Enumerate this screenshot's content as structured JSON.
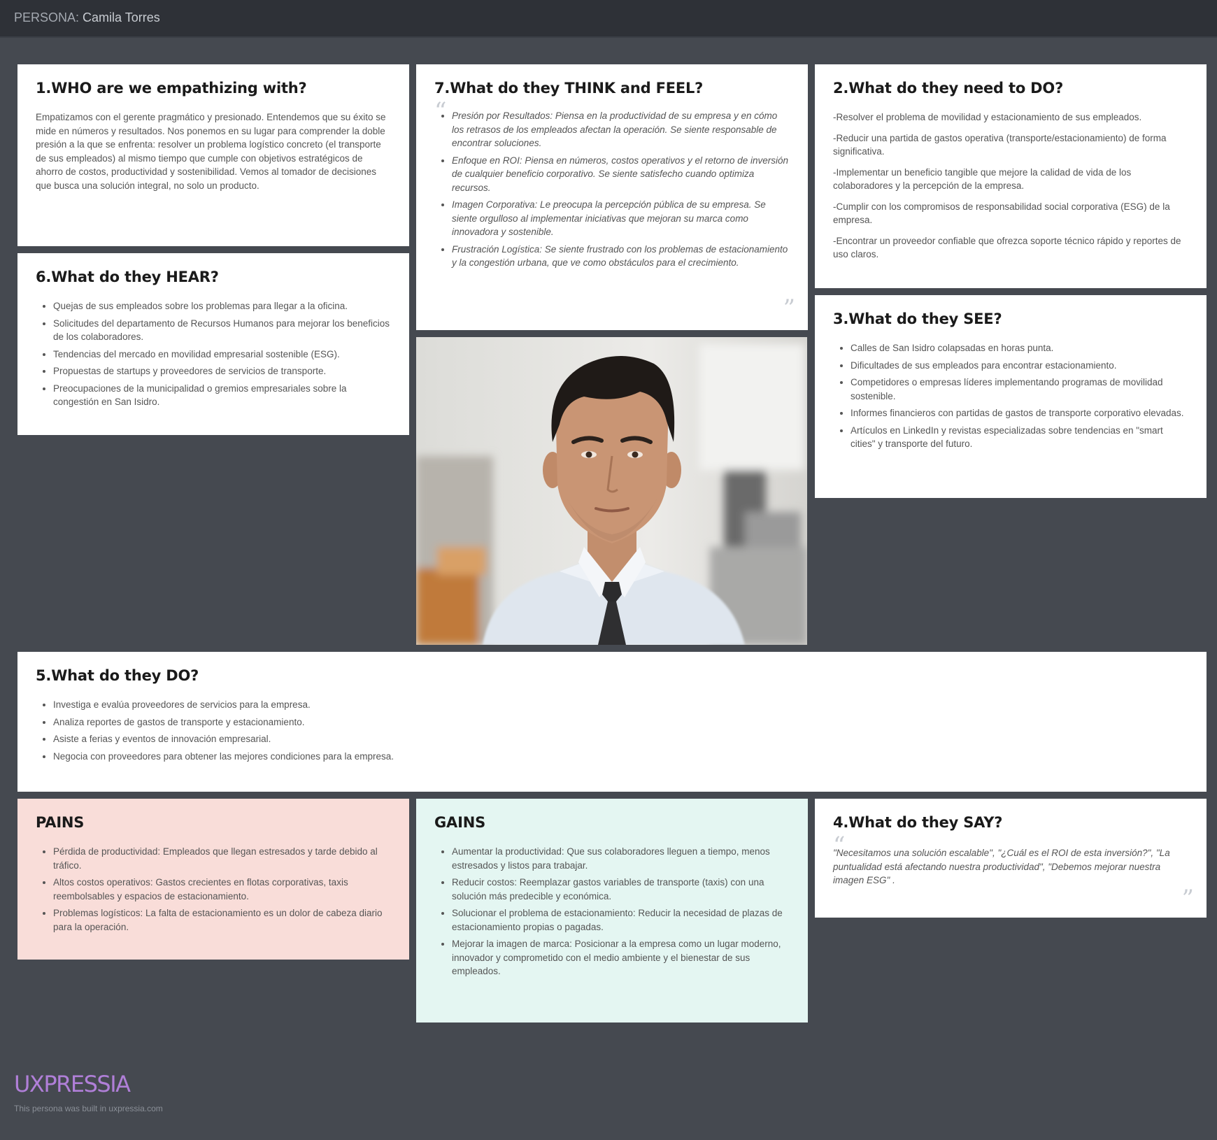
{
  "header": {
    "prefix": "PERSONA:",
    "name": "Camila Torres"
  },
  "who": {
    "title": "1.WHO are we empathizing with?",
    "body": "Empatizamos con el gerente pragmático y presionado. Entendemos que su éxito se mide en números y resultados. Nos ponemos en su lugar para comprender la doble presión a la que se enfrenta: resolver un problema logístico concreto (el transporte de sus empleados) al mismo tiempo que cumple con objetivos estratégicos de ahorro de costos, productividad y sostenibilidad. Vemos al tomador de decisiones que busca una solución integral, no solo un producto."
  },
  "think": {
    "title": "7.What do they THINK and FEEL?",
    "items": [
      "Presión por Resultados: Piensa en la productividad de su empresa y en cómo los retrasos de los empleados afectan la operación. Se siente responsable de encontrar soluciones.",
      "Enfoque en ROI: Piensa en números, costos operativos y el retorno de inversión de cualquier beneficio corporativo. Se siente satisfecho cuando optimiza recursos.",
      "Imagen Corporativa: Le preocupa la percepción pública de su empresa. Se siente orgulloso al implementar iniciativas que mejoran su marca como innovadora y sostenible.",
      "Frustración Logística: Se siente frustrado con los problemas de estacionamiento y la congestión urbana, que ve como obstáculos para el crecimiento."
    ]
  },
  "need": {
    "title": "2.What do they need to DO?",
    "items": [
      "-Resolver el problema de movilidad y estacionamiento de sus empleados.",
      "-Reducir una partida de gastos operativa (transporte/estacionamiento) de forma significativa.",
      "-Implementar un beneficio tangible que mejore la calidad de vida de los colaboradores y la percepción de la empresa.",
      "-Cumplir con los compromisos de responsabilidad social corporativa (ESG) de la empresa.",
      "-Encontrar un proveedor confiable que ofrezca soporte técnico rápido y reportes de uso claros."
    ]
  },
  "hear": {
    "title": "6.What do they HEAR?",
    "items": [
      "Quejas de sus empleados sobre los problemas para llegar a la oficina.",
      "Solicitudes del departamento de Recursos Humanos para mejorar los beneficios de los colaboradores.",
      "Tendencias del mercado en movilidad empresarial sostenible (ESG).",
      "Propuestas de startups y proveedores de servicios de transporte.",
      "Preocupaciones de la municipalidad o gremios empresariales sobre la congestión en San Isidro."
    ]
  },
  "see": {
    "title": "3.What do they SEE?",
    "items": [
      "Calles de San Isidro colapsadas en horas punta.",
      "Dificultades de sus empleados para encontrar estacionamiento.",
      "Competidores o empresas líderes implementando programas de movilidad sostenible.",
      "Informes financieros con partidas de gastos de transporte corporativo elevadas.",
      "Artículos en LinkedIn y revistas especializadas sobre tendencias en \"smart cities\" y transporte del futuro."
    ]
  },
  "do": {
    "title": "5.What do they DO?",
    "items": [
      "Investiga e evalúa proveedores de servicios para la empresa.",
      "Analiza reportes de gastos de transporte y estacionamiento.",
      "Asiste a ferias y eventos de innovación empresarial.",
      "Negocia con proveedores para obtener las mejores condiciones para la empresa."
    ]
  },
  "pains": {
    "title": "PAINS",
    "items": [
      "Pérdida de productividad: Empleados que llegan estresados y tarde debido al tráfico.",
      "Altos costos operativos: Gastos crecientes en flotas corporativas, taxis reembolsables y espacios de estacionamiento.",
      "Problemas logísticos: La falta de estacionamiento es un dolor de cabeza diario para la operación."
    ]
  },
  "gains": {
    "title": "GAINS",
    "items": [
      "Aumentar la productividad: Que sus colaboradores lleguen a tiempo, menos estresados y listos para trabajar.",
      "Reducir costos: Reemplazar gastos variables de transporte (taxis) con una solución más predecible y económica.",
      "Solucionar el problema de estacionamiento: Reducir la necesidad de plazas de estacionamiento propias o pagadas.",
      "Mejorar la imagen de marca: Posicionar a la empresa como un lugar moderno, innovador y comprometido con el medio ambiente y el bienestar de sus empleados."
    ]
  },
  "say": {
    "title": "4.What do they SAY?",
    "quote": "\"Necesitamos una solución escalable\", \"¿Cuál es el ROI de esta inversión?\", \"La puntualidad está afectando nuestra productividad\", \"Debemos mejorar nuestra imagen ESG\" ."
  },
  "quote_marks": {
    "open": "“",
    "close": "”"
  },
  "footer": {
    "logo": "UXPRESSIA",
    "note": "This persona was built in uxpressia.com"
  },
  "colors": {
    "background": "#454950",
    "topbar": "#2e3137",
    "card": "#ffffff",
    "pains": "#f9ddd9",
    "gains": "#e4f6f2",
    "logo": "#b07fd8"
  }
}
